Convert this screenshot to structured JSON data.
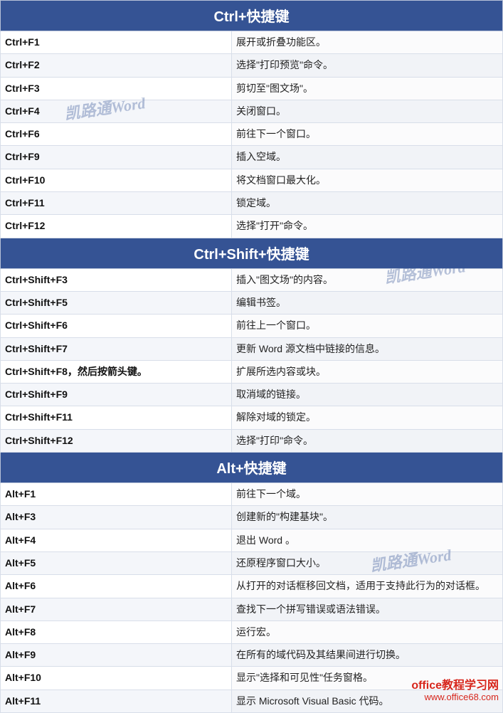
{
  "watermark": "凯路通Word",
  "branding": {
    "title": "office教程学习网",
    "url": "www.office68.com"
  },
  "sections": [
    {
      "header": "Ctrl+快捷键",
      "rows": [
        {
          "key": "Ctrl+F1",
          "desc": "展开或折叠功能区。"
        },
        {
          "key": "Ctrl+F2",
          "desc": "选择\"打印预览\"命令。"
        },
        {
          "key": "Ctrl+F3",
          "desc": "剪切至\"图文场\"。"
        },
        {
          "key": "Ctrl+F4",
          "desc": "关闭窗口。"
        },
        {
          "key": "Ctrl+F6",
          "desc": "前往下一个窗口。"
        },
        {
          "key": "Ctrl+F9",
          "desc": "插入空域。"
        },
        {
          "key": "Ctrl+F10",
          "desc": "将文档窗口最大化。"
        },
        {
          "key": "Ctrl+F11",
          "desc": "锁定域。"
        },
        {
          "key": "Ctrl+F12",
          "desc": "选择\"打开\"命令。"
        }
      ]
    },
    {
      "header": "Ctrl+Shift+快捷键",
      "rows": [
        {
          "key": "Ctrl+Shift+F3",
          "desc": "插入\"图文场\"的内容。"
        },
        {
          "key": "Ctrl+Shift+F5",
          "desc": "编辑书签。"
        },
        {
          "key": "Ctrl+Shift+F6",
          "desc": "前往上一个窗口。"
        },
        {
          "key": "Ctrl+Shift+F7",
          "desc": "更新 Word 源文档中链接的信息。"
        },
        {
          "key": "Ctrl+Shift+F8，然后按箭头键。",
          "desc": "扩展所选内容或块。"
        },
        {
          "key": "Ctrl+Shift+F9",
          "desc": "取消域的链接。"
        },
        {
          "key": "Ctrl+Shift+F11",
          "desc": "解除对域的锁定。"
        },
        {
          "key": "Ctrl+Shift+F12",
          "desc": "选择\"打印\"命令。"
        }
      ]
    },
    {
      "header": "Alt+快捷键",
      "rows": [
        {
          "key": "Alt+F1",
          "desc": "前往下一个域。"
        },
        {
          "key": "Alt+F3",
          "desc": "创建新的\"构建基块\"。"
        },
        {
          "key": "Alt+F4",
          "desc": "退出 Word 。"
        },
        {
          "key": "Alt+F5",
          "desc": "还原程序窗口大小。"
        },
        {
          "key": "Alt+F6",
          "desc": "从打开的对话框移回文档，适用于支持此行为的对话框。"
        },
        {
          "key": "Alt+F7",
          "desc": "查找下一个拼写错误或语法错误。"
        },
        {
          "key": "Alt+F8",
          "desc": "运行宏。"
        },
        {
          "key": "Alt+F9",
          "desc": "在所有的域代码及其结果间进行切换。"
        },
        {
          "key": "Alt+F10",
          "desc": "显示\"选择和可见性\"任务窗格。"
        },
        {
          "key": "Alt+F11",
          "desc": "显示 Microsoft Visual Basic 代码。"
        }
      ]
    }
  ]
}
